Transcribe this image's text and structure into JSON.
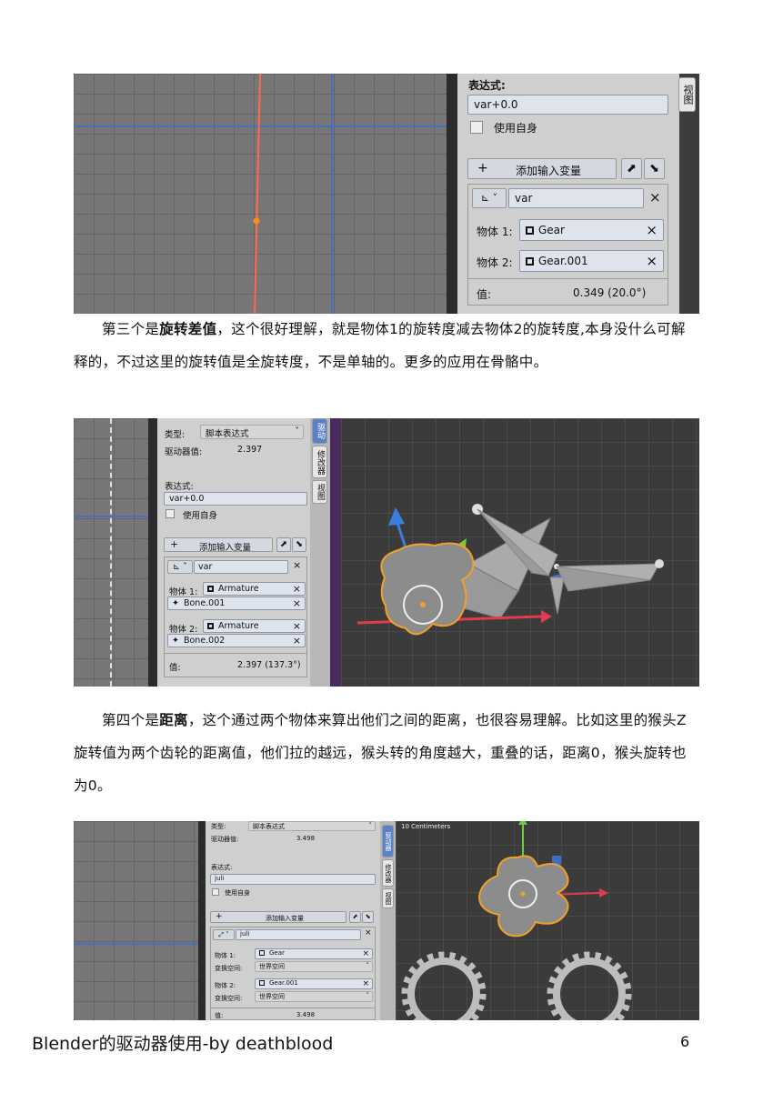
{
  "screenshot1": {
    "expression_label": "表达式:",
    "expression_value": "var+0.0",
    "use_self_label": "使用自身",
    "add_variable_label": "添加输入变量",
    "plus": "+",
    "variable_name": "var",
    "object1_label": "物体 1:",
    "object1_value": "Gear",
    "object2_label": "物体 2:",
    "object2_value": "Gear.001",
    "value_label": "值:",
    "value": "0.349 (20.0°)",
    "close": "×",
    "view_tab": "视图"
  },
  "paragraph1": {
    "prefix": "第三个是",
    "bold": "旋转差值",
    "text": "，这个很好理解，就是物体1的旋转度减去物体2的旋转度,本身没什么可解释的，不过这里的旋转值是全旋转度，不是单轴的。更多的应用在骨骼中。"
  },
  "screenshot2": {
    "type_label": "类型:",
    "type_value": "脚本表达式",
    "driver_value_label": "驱动器值:",
    "driver_value": "2.397",
    "expression_label": "表达式:",
    "expression_value": "var+0.0",
    "use_self_label": "使用自身",
    "plus": "+",
    "add_variable_label": "添加输入变量",
    "variable_name": "var",
    "object1_label": "物体 1:",
    "object1_value": "Armature",
    "bone1_value": "Bone.001",
    "object2_label": "物体 2:",
    "object2_value": "Armature",
    "bone2_value": "Bone.002",
    "value_label": "值:",
    "value": "2.397 (137.3°)",
    "close": "×",
    "tab_driver": "驱动",
    "tab_modifier": "修改器",
    "tab_view": "视图"
  },
  "paragraph2": {
    "prefix": "第四个是",
    "bold": "距离",
    "text": "，这个通过两个物体来算出他们之间的距离，也很容易理解。比如这里的猴头Z旋转值为两个齿轮的距离值，他们拉的越远，猴头转的角度越大，重叠的话，距离0，猴头旋转也为0。"
  },
  "screenshot3": {
    "type_label": "类型:",
    "type_value": "脚本表达式",
    "driver_value_label": "驱动器值:",
    "driver_value": "3.498",
    "expression_label": "表达式:",
    "expression_value": "juli",
    "use_self_label": "使用自身",
    "plus": "+",
    "add_variable_label": "添加输入变量",
    "variable_name": "juli",
    "object1_label": "物体 1:",
    "object1_value": "Gear",
    "space1_label": "变换空间:",
    "space1_value": "世界空间",
    "object2_label": "物体 2:",
    "object2_value": "Gear.001",
    "space2_label": "变换空间:",
    "space2_value": "世界空间",
    "value_label": "值:",
    "value": "3.498",
    "close": "×",
    "tab_driver": "驱动器",
    "tab_modifier": "修改器",
    "tab_view": "视图",
    "viewport_label": "10 Centimeters"
  },
  "footer": {
    "title": "Blender的驱动器使用-by deathblood",
    "page_number": "6"
  }
}
